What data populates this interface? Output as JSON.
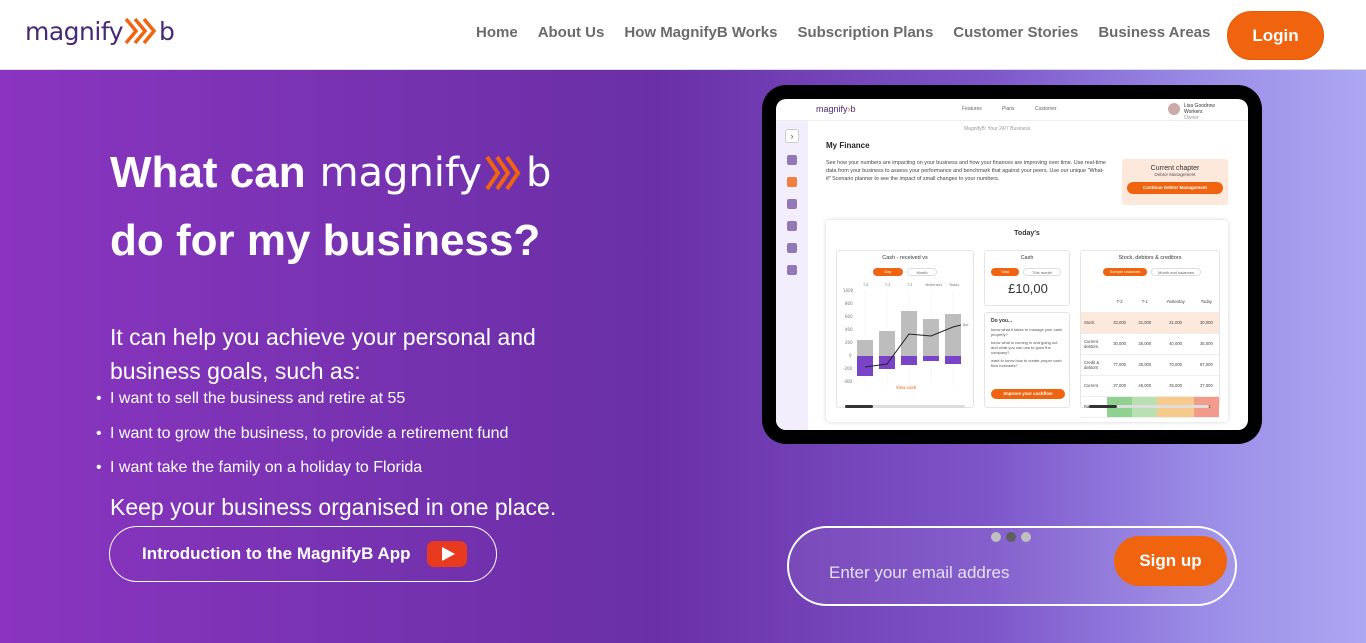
{
  "nav": {
    "logo_text": "magnify",
    "logo_suffix": "b",
    "links": [
      "Home",
      "About Us",
      "How MagnifyB Works",
      "Subscription Plans",
      "Customer Stories",
      "Business Areas"
    ],
    "login_label": "Login"
  },
  "hero": {
    "headline_part1": "What can",
    "headline_brand": "magnify",
    "headline_brand_suffix": "b",
    "headline_part2": "do for my business?",
    "intro": "It can help you achieve your personal and business goals, such as:",
    "bullets": [
      "I want to sell the business and retire at 55",
      "I want to grow the business, to provide a retirement fund",
      "I want take the family on a holiday to Florida"
    ],
    "tagline": "Keep your business organised in one place.",
    "video_button_label": "Introduction to the MagnifyB App"
  },
  "preview": {
    "app_logo": "magnify",
    "app_logo_suffix": "b",
    "app_nav": [
      "Features",
      "Plans",
      "Customer"
    ],
    "user_name": "Lisa Goodrow",
    "user_sub": "Workers",
    "user_role": "Owner",
    "subheader": "MagnifyB: Your 24/7 Business",
    "section_title": "My Finance",
    "description": "See how your numbers are impacting on your business and how your finances are improving over time. Use real-time data from your business to assess your performance and benchmark that against your peers. Use our unique \"What-if\" Scenario planner to see the impact of small changes to your numbers.",
    "chapter_title": "Current chapter",
    "chapter_sub": "Debtor Management",
    "chapter_button": "Continue Debtor Management",
    "today_label": "Today's",
    "cash_card": {
      "title": "Cash - received vs",
      "pill_on": "Day",
      "pill_off": "Month",
      "link": "View cash",
      "y_ticks": [
        "1000",
        "800",
        "600",
        "400",
        "200",
        "0",
        "-200",
        "-400"
      ],
      "x_ticks": [
        "T-4",
        "T-3",
        "T-2",
        "Yesterday",
        "Today"
      ],
      "line_end_label": "Bal"
    },
    "cash_box": {
      "title": "Cash",
      "pill_on": "Total",
      "pill_off": "This month",
      "amount": "£10,00"
    },
    "do_you": {
      "title": "Do you...",
      "items": [
        "know what it takes to manage your cash properly?",
        "know what is coming in and going out and what you can use to grow the company?",
        "want to know how to create proper cash flow forecasts?"
      ],
      "button": "Improve your cashflow"
    },
    "stock_card": {
      "title": "Stock, debtors & creditors",
      "pill_on": "Sample balances",
      "pill_off": "Month end balances",
      "columns": [
        "T-2",
        "T-1",
        "Yesterday",
        "Today"
      ],
      "rows": [
        {
          "label": "Stock",
          "values": [
            "33,000",
            "31,000",
            "31,000",
            "30,000"
          ]
        },
        {
          "label": "Current debtors",
          "values": [
            "30,000",
            "35,000",
            "40,000",
            "35,000"
          ]
        },
        {
          "label": "Credit & debtors",
          "values": [
            "77,000",
            "35,000",
            "70,000",
            "67,000"
          ]
        },
        {
          "label": "Current",
          "values": [
            "37,000",
            "46,000",
            "35,000",
            "37,000"
          ]
        },
        {
          "label": "Ratio",
          "values": [
            "3.80",
            "3.35",
            "2.02",
            "1.83"
          ]
        }
      ],
      "ratio_colors": [
        "#8fd18f",
        "#b8e0b0",
        "#f7c98a",
        "#f29b8a"
      ]
    },
    "carousel": {
      "count": 3,
      "active": 1
    }
  },
  "signup": {
    "placeholder": "Enter your email addres",
    "button_label": "Sign up"
  },
  "colors": {
    "accent": "#f0640f",
    "brand": "#4a2a78"
  }
}
